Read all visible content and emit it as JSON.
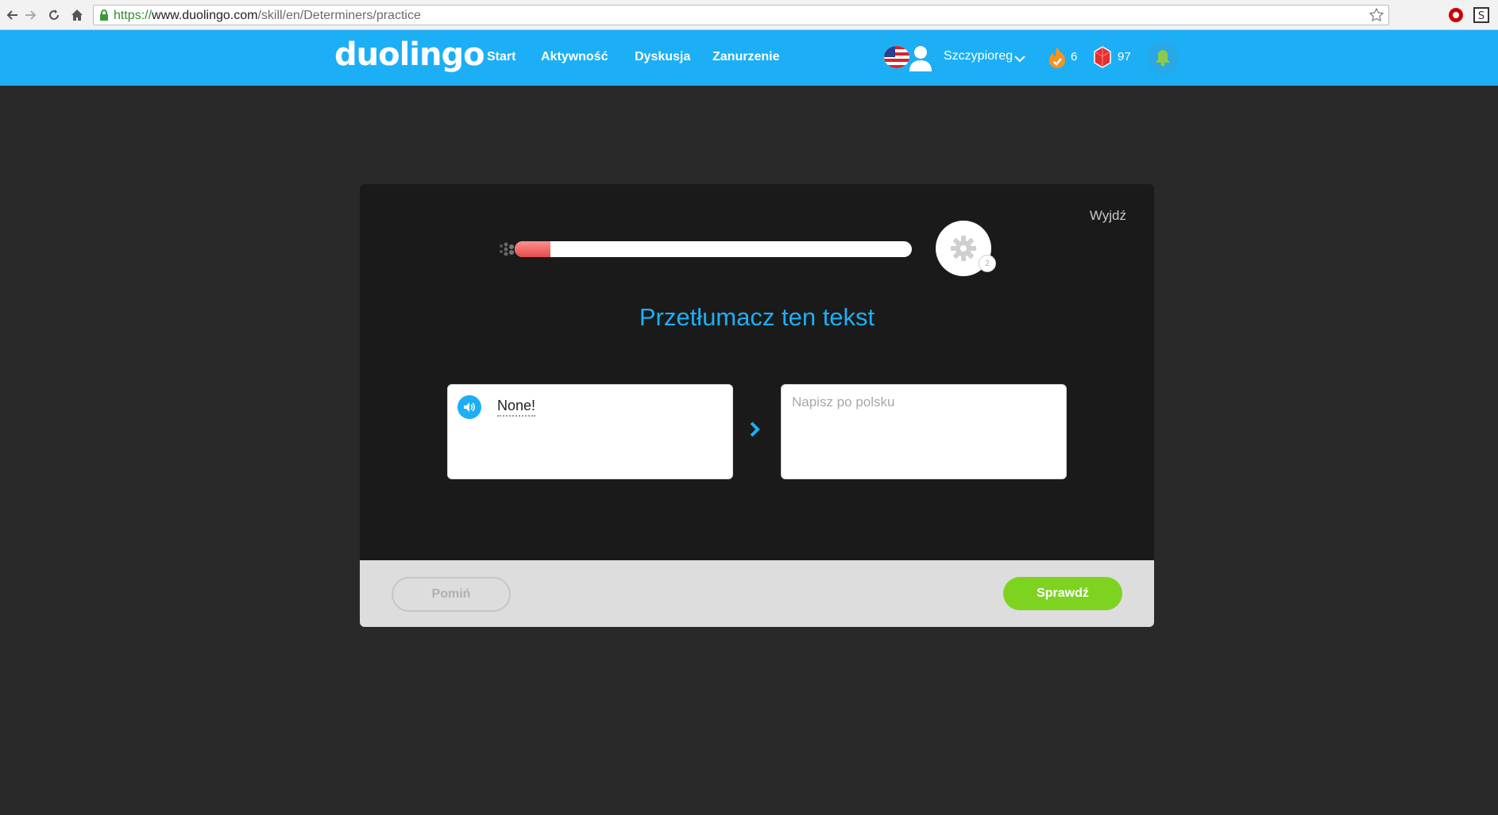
{
  "browser": {
    "url_scheme": "https://",
    "url_host": "www.duolingo.com",
    "url_path": "/skill/en/Determiners/practice"
  },
  "header": {
    "logo": "duolingo",
    "nav": [
      "Start",
      "Aktywność",
      "Dyskusja",
      "Zanurzenie"
    ],
    "username": "Szczypioreg",
    "streak": "6",
    "lingots": "97",
    "brand_color": "#1caff6"
  },
  "lesson": {
    "exit_label": "Wyjdź",
    "progress_fraction": 0.09,
    "gear_number": "2",
    "prompt": "Przetłumacz ten tekst",
    "source_sentence": "None!",
    "answer_placeholder": "Napisz po polsku",
    "answer_value": "",
    "skip_label": "Pomiń",
    "check_label": "Sprawdź",
    "check_color": "#7ed321"
  },
  "icons": [
    "back-arrow-icon",
    "forward-arrow-icon",
    "reload-icon",
    "home-icon",
    "lock-icon",
    "star-icon",
    "us-flag-icon",
    "user-avatar-icon",
    "chevron-down-icon",
    "flame-icon",
    "lingot-gem-icon",
    "bell-icon",
    "gear-icon",
    "speaker-icon",
    "chevron-right-icon"
  ]
}
